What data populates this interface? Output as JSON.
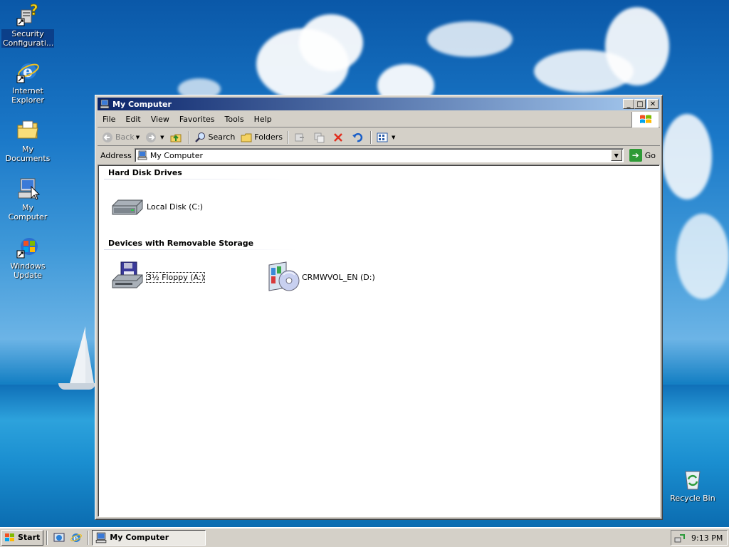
{
  "desktop": {
    "icons": [
      {
        "label": "Security Configurati..."
      },
      {
        "label": "Internet Explorer"
      },
      {
        "label": "My Documents"
      },
      {
        "label": "My Computer"
      },
      {
        "label": "Windows Update"
      },
      {
        "label": "Recycle Bin"
      }
    ]
  },
  "window": {
    "title": "My Computer",
    "menu": [
      "File",
      "Edit",
      "View",
      "Favorites",
      "Tools",
      "Help"
    ],
    "toolbar": {
      "back_label": "Back",
      "search_label": "Search",
      "folders_label": "Folders"
    },
    "address": {
      "label": "Address",
      "value": "My Computer",
      "go_label": "Go"
    },
    "groups": [
      {
        "title": "Hard Disk Drives",
        "items": [
          {
            "label": "Local Disk (C:)"
          }
        ]
      },
      {
        "title": "Devices with Removable Storage",
        "items": [
          {
            "label": "3½ Floppy (A:)"
          },
          {
            "label": "CRMWVOL_EN (D:)"
          }
        ]
      }
    ]
  },
  "taskbar": {
    "start_label": "Start",
    "task_label": "My Computer",
    "clock": "9:13 PM"
  },
  "colors": {
    "titlebar_start": "#0a246a",
    "titlebar_end": "#a6caf0",
    "chrome": "#d4d0c8"
  }
}
